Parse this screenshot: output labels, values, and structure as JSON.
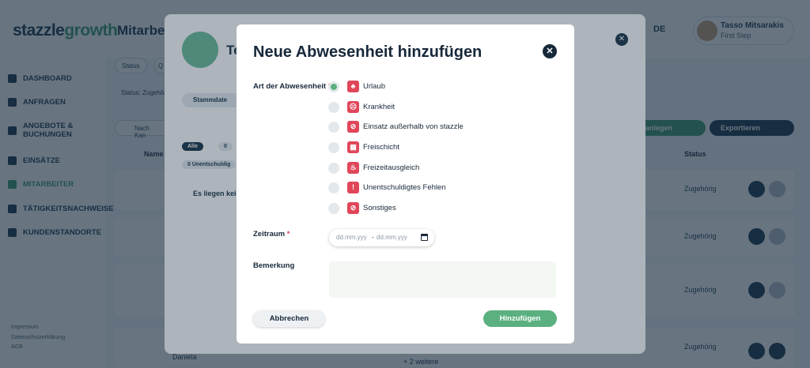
{
  "header": {
    "logo_main": "stazzle",
    "logo_accent": "growth",
    "breadcrumb": "Mitarbeiter",
    "lang": "DE",
    "user_name": "Tasso Mitsarakis",
    "user_role": "First Step"
  },
  "sidebar": {
    "items": [
      {
        "label": "DASHBOARD",
        "icon": "home-icon"
      },
      {
        "label": "ANFRAGEN",
        "icon": "user-plus-icon"
      },
      {
        "label": "ANGEBOTE & BUCHUNGEN",
        "icon": "offers-icon"
      },
      {
        "label": "EINSÄTZE",
        "icon": "target-icon"
      },
      {
        "label": "MITARBEITER",
        "icon": "team-icon",
        "active": true
      },
      {
        "label": "TÄTIGKEITSNACHWEISE",
        "icon": "list-icon"
      },
      {
        "label": "KUNDENSTANDORTE",
        "icon": "building-icon"
      }
    ],
    "footer": [
      "Impressum",
      "Datenschutzerklärung",
      "AGB"
    ]
  },
  "background": {
    "filter_status": "Status",
    "filter_q": "Q",
    "status_filter": "Status: Zugehörig",
    "search_placeholder": "Nach Kan",
    "col_name": "Name",
    "col_status": "Status",
    "export_label": "Exportieren",
    "create_label": "ten anlegen",
    "row_status": "Zugehörig",
    "row_last_name": "Daniela",
    "row_more": "+ 2 weitere",
    "chip_all": "Alle",
    "chip_zero": "0",
    "chip_unexcused": "0   Unentschuldig"
  },
  "panel": {
    "title": "Te",
    "tab": "Stammdate",
    "empty": "Es liegen kei"
  },
  "modal": {
    "title": "Neue Abwesenheit hinzufügen",
    "close": "✕",
    "type_label": "Art der Abwesenheit",
    "options": [
      {
        "label": "Urlaub",
        "icon": "palm-icon",
        "selected": true
      },
      {
        "label": "Krankheit",
        "icon": "sick-icon",
        "selected": false
      },
      {
        "label": "Einsatz außerhalb von stazzle",
        "icon": "external-icon",
        "selected": false
      },
      {
        "label": "Freischicht",
        "icon": "calendar-off-icon",
        "selected": false
      },
      {
        "label": "Freizeitausgleich",
        "icon": "leisure-icon",
        "selected": false
      },
      {
        "label": "Unentschuldigtes Fehlen",
        "icon": "warning-icon",
        "selected": false
      },
      {
        "label": "Sonstiges",
        "icon": "other-icon",
        "selected": false
      }
    ],
    "period_label": "Zeitraum",
    "date_from_placeholder": "dd.mm.yyy",
    "date_sep": "-",
    "date_to_placeholder": "dd.mm.yyy",
    "note_label": "Bemerkung",
    "cancel_label": "Abbrechen",
    "submit_label": "Hinzufügen",
    "accent": "#5bb07f",
    "icon_color": "#e0465a"
  }
}
